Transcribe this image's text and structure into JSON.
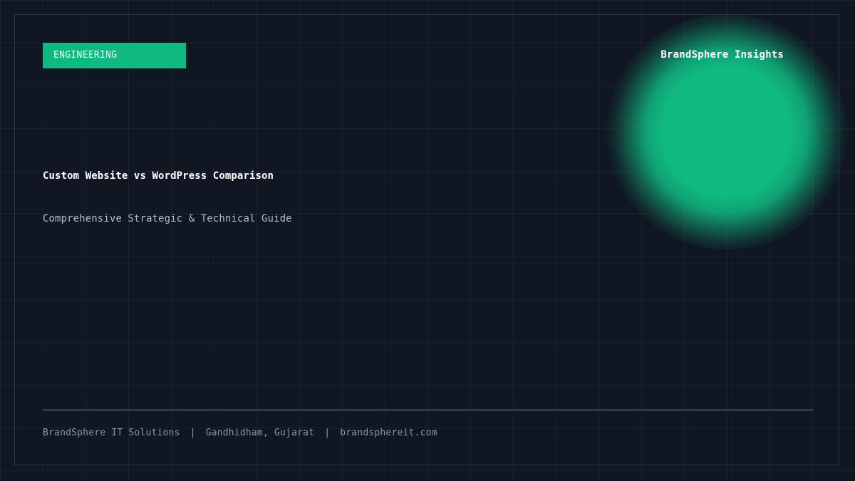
{
  "tag": {
    "label": "ENGINEERING"
  },
  "brand": {
    "name": "BrandSphere Insights"
  },
  "headline": {
    "title": "Custom Website vs WordPress Comparison",
    "subtitle": "Comprehensive Strategic & Technical Guide"
  },
  "footer": {
    "company": "BrandSphere IT Solutions",
    "location": "Gandhidham, Gujarat",
    "website": "brandsphereit.com",
    "separator": "|"
  },
  "colors": {
    "background": "#111722",
    "accent": "#10b981",
    "title_text": "#ffffff",
    "subtitle_text": "#b4bcc6",
    "footer_text": "#8e96a1"
  }
}
